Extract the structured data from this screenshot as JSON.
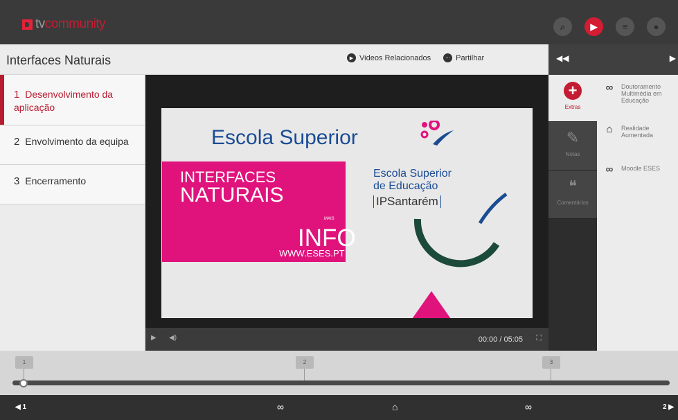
{
  "app": {
    "logo_tv": "tv",
    "logo_name": "community"
  },
  "top_icons": [
    {
      "name": "search-icon",
      "glyph": "⌕"
    },
    {
      "name": "play-icon",
      "glyph": "▶"
    },
    {
      "name": "list-icon",
      "glyph": "≡"
    },
    {
      "name": "user-icon",
      "glyph": "●"
    }
  ],
  "header": {
    "title": "Interfaces Naturais",
    "related_label": "Videos Relacionados",
    "share_label": "Partilhar"
  },
  "panel_nav": {
    "prev_glyph": "◀◀",
    "next_glyph": "▶"
  },
  "chapters": [
    {
      "num": "1",
      "label": "Desenvolvimento da aplicação",
      "active": true
    },
    {
      "num": "2",
      "label": "Envolvimento da equipa"
    },
    {
      "num": "3",
      "label": "Encerramento"
    }
  ],
  "video": {
    "slide_title": "Escola Superior",
    "slide_title_cut": "de Educação",
    "pink_line1": "INTERFACES",
    "pink_line2": "NATURAIS",
    "pink_mais": "MAIS",
    "pink_info": "INFO",
    "pink_www": "WWW.ESES.PT",
    "school_line1": "Escola Superior",
    "school_line2": "de Educação",
    "school_line3": "IPSantarém",
    "time": "00:00 / 05:05"
  },
  "tabs": [
    {
      "label": "Extras",
      "glyph": "+",
      "active": true
    },
    {
      "label": "Notas",
      "glyph": "✎"
    },
    {
      "label": "Comentários",
      "glyph": "❝"
    }
  ],
  "extras": [
    {
      "label": "Doutoramento Multimédia em Educação",
      "icon": "link-icon",
      "glyph": "∞"
    },
    {
      "label": "Realidade Aumentada",
      "icon": "book-icon",
      "glyph": "⌂"
    },
    {
      "label": "Moodle ESES",
      "icon": "link-icon",
      "glyph": "∞"
    }
  ],
  "timeline": {
    "markers": [
      "1",
      "2",
      "3"
    ],
    "progress": 0
  },
  "bottom": {
    "prev": "◀ 1",
    "next": "2 ▶"
  },
  "colors": {
    "accent": "#b81c31",
    "pink": "#e0137d",
    "navy": "#1a4c94"
  }
}
